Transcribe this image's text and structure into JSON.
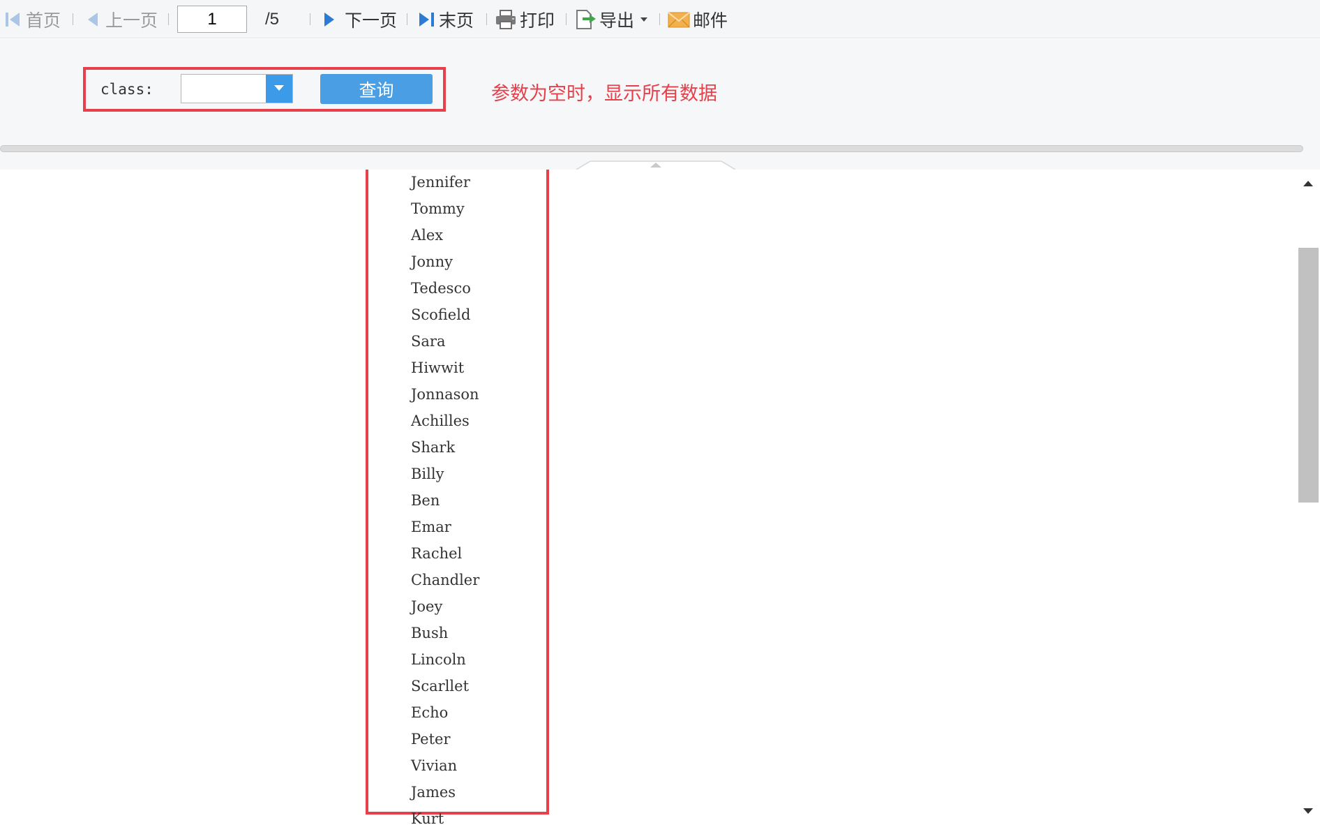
{
  "toolbar": {
    "first_label": "首页",
    "prev_label": "上一页",
    "page_value": "1",
    "page_total": "/5",
    "next_label": "下一页",
    "last_label": "末页",
    "print_label": "打印",
    "export_label": "导出",
    "mail_label": "邮件",
    "icons": {
      "first": "first-page-icon",
      "prev": "prev-page-icon",
      "next": "next-page-icon",
      "last": "last-page-icon",
      "print": "printer-icon",
      "export": "export-icon",
      "export_menu": "caret-down-icon",
      "mail": "envelope-icon"
    }
  },
  "params": {
    "class_label": "class:",
    "class_value": "",
    "query_label": "查询",
    "annotation": "参数为空时，显示所有数据"
  },
  "names": [
    "Jennifer",
    "Tommy",
    "Alex",
    "Jonny",
    "Tedesco",
    "Scofield",
    "Sara",
    "Hiwwit",
    "Jonnason",
    "Achilles",
    "Shark",
    "Billy",
    "Ben",
    "Emar",
    "Rachel",
    "Chandler",
    "Joey",
    "Bush",
    "Lincoln",
    "Scarllet",
    "Echo",
    "Peter",
    "Vivian",
    "James",
    "Kurt"
  ],
  "colors": {
    "accent": "#4a9fe4",
    "highlight": "#e8404a",
    "nav_arrow": "#2b7bd4",
    "disabled": "#9a9a9a"
  }
}
